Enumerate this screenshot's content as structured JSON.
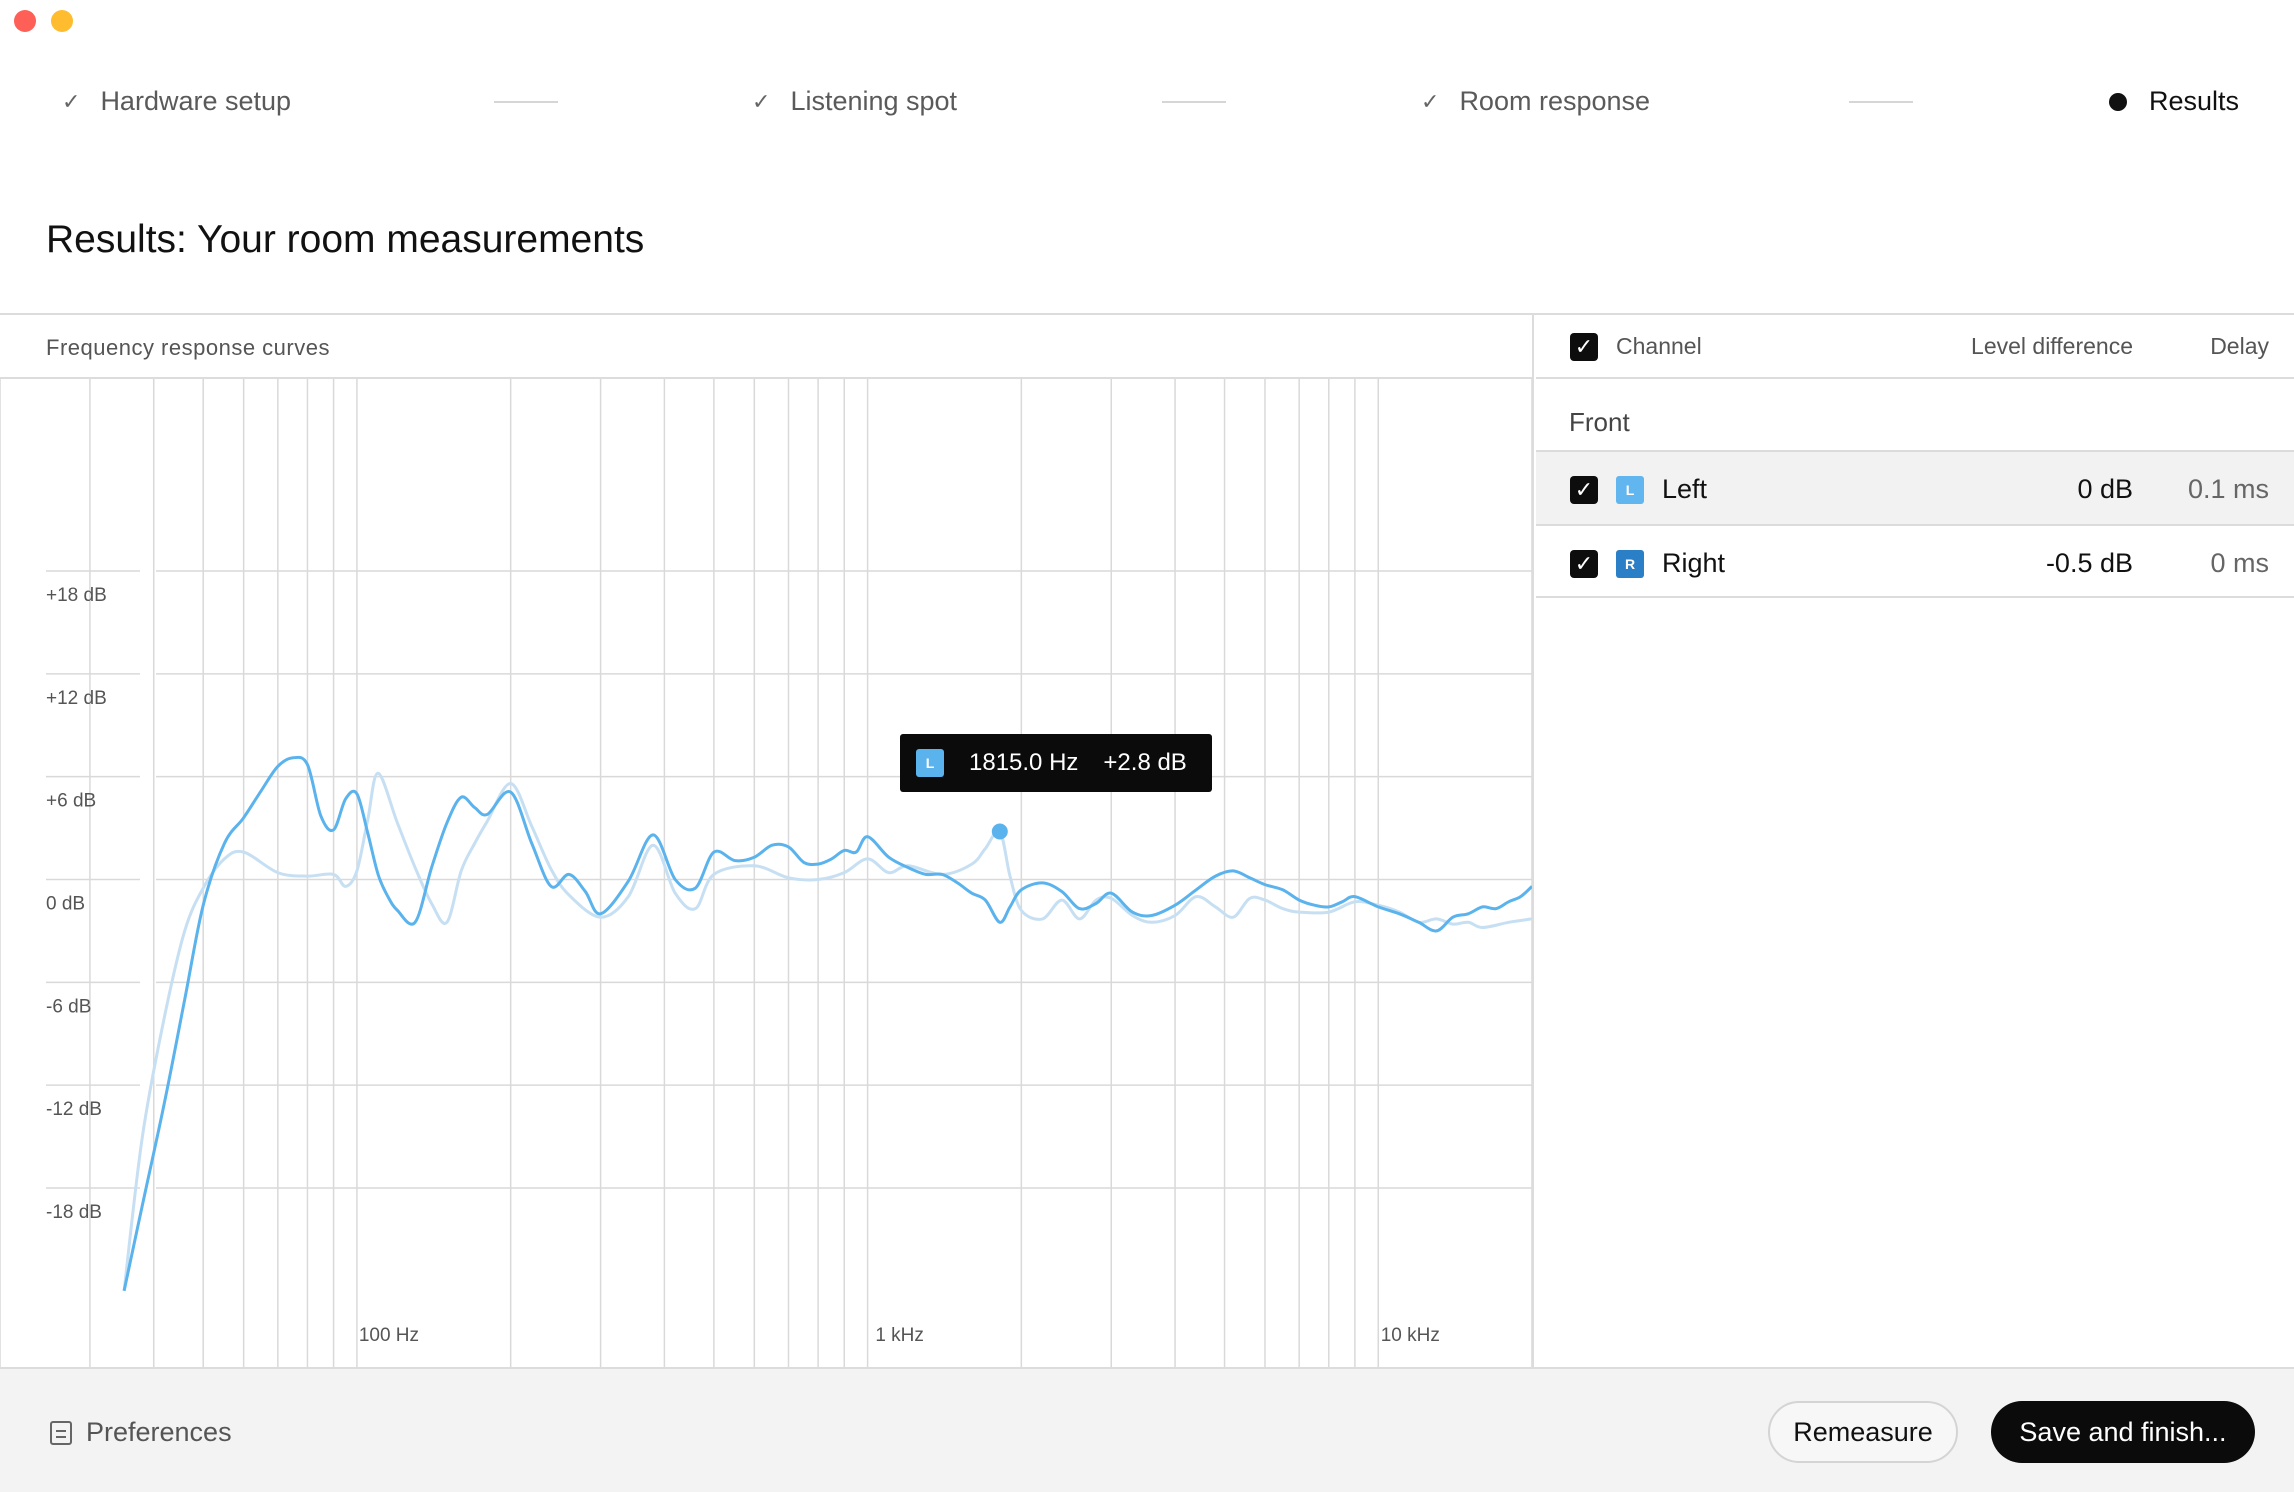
{
  "window": {
    "traffic_lights": [
      "close",
      "minimize"
    ]
  },
  "stepper": {
    "steps": [
      {
        "label": "Hardware setup",
        "state": "done",
        "icon": "check-icon"
      },
      {
        "label": "Listening spot",
        "state": "done",
        "icon": "check-icon"
      },
      {
        "label": "Room response",
        "state": "done",
        "icon": "check-icon"
      },
      {
        "label": "Results",
        "state": "active",
        "icon": "dot-icon"
      }
    ]
  },
  "page": {
    "title": "Results: Your room measurements"
  },
  "chart": {
    "header": "Frequency response curves"
  },
  "tooltip": {
    "channel_tag": "L",
    "frequency": "1815.0 Hz",
    "level": "+2.8 dB"
  },
  "channels": {
    "header": {
      "channel": "Channel",
      "level_difference": "Level difference",
      "delay": "Delay"
    },
    "group": "Front",
    "rows": [
      {
        "tag": "L",
        "name": "Left",
        "level": "0 dB",
        "delay": "0.1 ms",
        "color": "#62b6ef",
        "checked": true,
        "selected": true
      },
      {
        "tag": "R",
        "name": "Right",
        "level": "-0.5 dB",
        "delay": "0 ms",
        "color": "#2b7fc7",
        "checked": true,
        "selected": false
      }
    ]
  },
  "footer": {
    "preferences_label": "Preferences",
    "remeasure_label": "Remeasure",
    "save_label": "Save and finish..."
  },
  "chart_data": {
    "type": "line",
    "x_scale": "log",
    "xlim": [
      20,
      20000
    ],
    "ylim": [
      -24,
      24
    ],
    "x_ticks": [
      {
        "value": 100,
        "label": "100 Hz"
      },
      {
        "value": 1000,
        "label": "1 kHz"
      },
      {
        "value": 10000,
        "label": "10 kHz"
      }
    ],
    "y_ticks": [
      {
        "value": 18,
        "label": "+18 dB"
      },
      {
        "value": 12,
        "label": "+12 dB"
      },
      {
        "value": 6,
        "label": "+6 dB"
      },
      {
        "value": 0,
        "label": "0 dB"
      },
      {
        "value": -6,
        "label": "-6 dB"
      },
      {
        "value": -12,
        "label": "-12 dB"
      },
      {
        "value": -18,
        "label": "-18 dB"
      }
    ],
    "grid": true,
    "highlight": {
      "series": "L",
      "x": 1815,
      "y": 2.8
    },
    "series": [
      {
        "name": "L",
        "color": "#5ab3ec",
        "x": [
          35,
          38,
          42,
          46,
          50,
          55,
          60,
          65,
          70,
          75,
          80,
          85,
          90,
          95,
          100,
          105,
          110,
          115,
          120,
          130,
          140,
          150,
          160,
          170,
          180,
          200,
          220,
          240,
          260,
          280,
          300,
          340,
          380,
          420,
          460,
          500,
          550,
          600,
          650,
          700,
          750,
          800,
          850,
          900,
          950,
          1000,
          1100,
          1200,
          1300,
          1400,
          1500,
          1600,
          1700,
          1815,
          1900,
          2000,
          2200,
          2400,
          2600,
          2800,
          3000,
          3300,
          3600,
          4000,
          4400,
          4800,
          5200,
          5600,
          6000,
          6500,
          7000,
          7500,
          8000,
          8500,
          9000,
          10000,
          11000,
          12000,
          13000,
          14000,
          15000,
          16000,
          17000,
          18000,
          19000,
          20000
        ],
        "y": [
          -24,
          -19,
          -13,
          -7,
          -1.5,
          2.1,
          3.6,
          5.2,
          6.6,
          7.1,
          6.7,
          3.7,
          2.9,
          4.7,
          5,
          2.7,
          0.3,
          -1,
          -1.8,
          -2.5,
          0.7,
          3.3,
          4.8,
          4.2,
          3.8,
          5.1,
          2.1,
          -0.4,
          0.3,
          -0.7,
          -2,
          -0.1,
          2.6,
          0,
          -0.5,
          1.6,
          1.1,
          1.3,
          2,
          1.9,
          1,
          0.9,
          1.2,
          1.7,
          1.6,
          2.5,
          1.3,
          0.7,
          0.3,
          0.3,
          -0.2,
          -0.8,
          -1.2,
          -2.5,
          -1.6,
          -0.6,
          -0.2,
          -0.7,
          -1.7,
          -1.4,
          -0.8,
          -1.9,
          -2.1,
          -1.5,
          -0.6,
          0.2,
          0.5,
          0.1,
          -0.3,
          -0.6,
          -1.2,
          -1.5,
          -1.6,
          -1.3,
          -1,
          -1.6,
          -2,
          -2.5,
          -3,
          -2.2,
          -2,
          -1.6,
          -1.7,
          -1.3,
          -1,
          -0.4
        ]
      },
      {
        "name": "R",
        "color": "#c6dff2",
        "x": [
          35,
          38,
          42,
          46,
          50,
          55,
          60,
          70,
          80,
          90,
          95,
          100,
          105,
          110,
          120,
          130,
          140,
          150,
          160,
          170,
          180,
          200,
          220,
          240,
          260,
          300,
          340,
          380,
          420,
          460,
          500,
          600,
          700,
          800,
          900,
          1000,
          1100,
          1200,
          1400,
          1600,
          1700,
          1815,
          1900,
          2000,
          2200,
          2400,
          2600,
          2800,
          3000,
          3300,
          3600,
          4000,
          4400,
          4800,
          5200,
          5600,
          6000,
          6500,
          7000,
          8000,
          9000,
          10000,
          11000,
          12000,
          13000,
          14000,
          15000,
          16000,
          18000,
          20000
        ],
        "y": [
          -24,
          -15,
          -8,
          -3,
          -0.5,
          1.2,
          1.6,
          0.4,
          0.2,
          0.3,
          -0.4,
          0.5,
          3.5,
          6.2,
          3.3,
          0.7,
          -1.4,
          -2.5,
          0.5,
          2.1,
          3.4,
          5.6,
          3.1,
          0.6,
          -0.9,
          -2.2,
          -1,
          2,
          -0.8,
          -1.7,
          0.3,
          0.8,
          0.1,
          0,
          0.4,
          1.2,
          0.4,
          0.8,
          0.3,
          0.9,
          1.8,
          2.8,
          0.2,
          -1.8,
          -2.3,
          -1.2,
          -2.3,
          -1.2,
          -1.1,
          -2.1,
          -2.5,
          -2.1,
          -1,
          -1.6,
          -2.2,
          -1.1,
          -1.2,
          -1.7,
          -1.9,
          -1.9,
          -1.3,
          -1.5,
          -1.9,
          -2.5,
          -2.3,
          -2.6,
          -2.5,
          -2.8,
          -2.5,
          -2.3
        ]
      }
    ]
  }
}
